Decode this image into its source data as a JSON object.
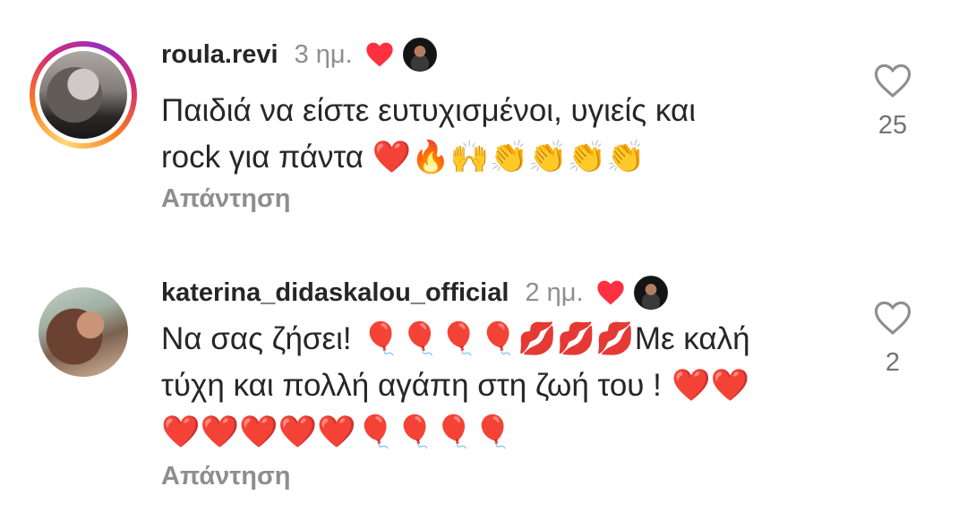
{
  "comments": [
    {
      "username": "roula.revi",
      "time": "3 ημ.",
      "text_line1": "Παιδιά να είστε ευτυχισμένοι, υγιείς και",
      "text_line2": "rock για πάντα",
      "text_line2_emoji": "❤️🔥🙌👏👏👏👏",
      "reply": "Απάντηση",
      "likes": "25",
      "liked_by_creator": true
    },
    {
      "username": "katerina_didaskalou_official",
      "time": "2 ημ.",
      "text_line1_start": "Να σας ζήσει!",
      "text_line1_emoji": " 🎈🎈🎈🎈💋💋💋",
      "text_line1_end": "Με καλή",
      "text_line2": "τύχη και πολλή αγάπη στη ζωή του !",
      "text_line2_emoji": " ❤️❤️",
      "text_line3_emoji": "❤️❤️❤️❤️❤️🎈🎈🎈🎈",
      "reply": "Απάντηση",
      "likes": "2",
      "liked_by_creator": true
    }
  ],
  "colors": {
    "text": "#262626",
    "muted": "#8e8e8e",
    "heart": "#ff3040"
  },
  "icons": {
    "creator_like": "red-heart-icon",
    "like": "heart-outline-icon"
  }
}
